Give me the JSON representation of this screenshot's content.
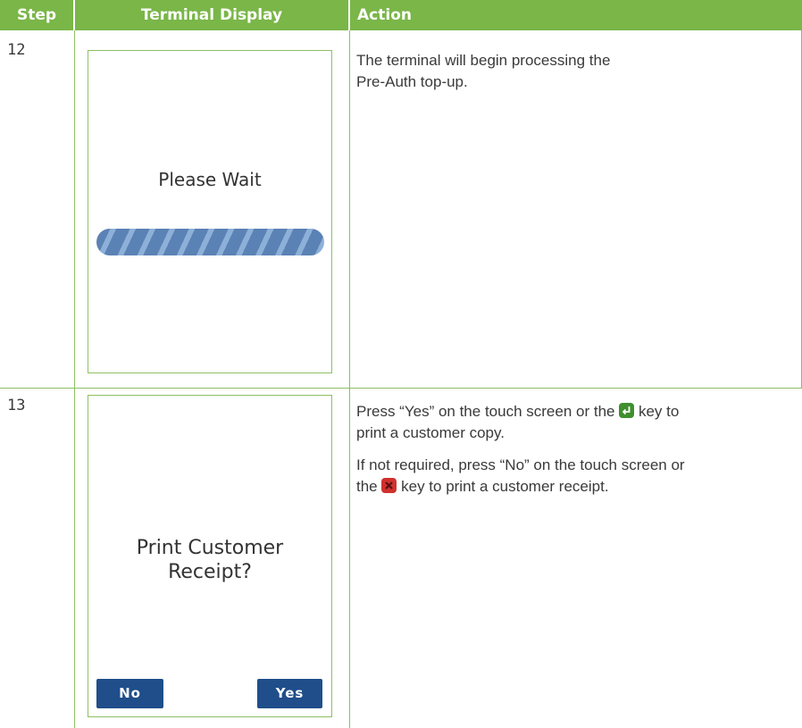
{
  "header": {
    "step": "Step",
    "display": "Terminal Display",
    "action": "Action"
  },
  "rows": [
    {
      "step": "12",
      "screen": {
        "message": "Please Wait",
        "icon": "progress-bar-indeterminate"
      },
      "action": {
        "line1": "The terminal will begin processing the",
        "line2": "Pre-Auth top-up."
      }
    },
    {
      "step": "13",
      "screen": {
        "message_line1": "Print Customer",
        "message_line2": "Receipt?",
        "no_label": "No",
        "yes_label": "Yes"
      },
      "action": {
        "para1_a": "Press “Yes” on the touch screen or the",
        "para1_b": "key to",
        "para1_c": "print a customer copy.",
        "para2_a": "If not required, press “No” on the touch screen or",
        "para2_b": "the",
        "para2_c": "key to print a customer receipt.",
        "enter_key_icon": "enter-key-icon",
        "cancel_key_icon": "cancel-key-icon"
      }
    }
  ],
  "colors": {
    "header_bg": "#7ab648",
    "grid_line": "#8cc063",
    "button_bg": "#1f4e8a",
    "enter_key": "#3f8f2e",
    "cancel_key": "#d0312d"
  }
}
